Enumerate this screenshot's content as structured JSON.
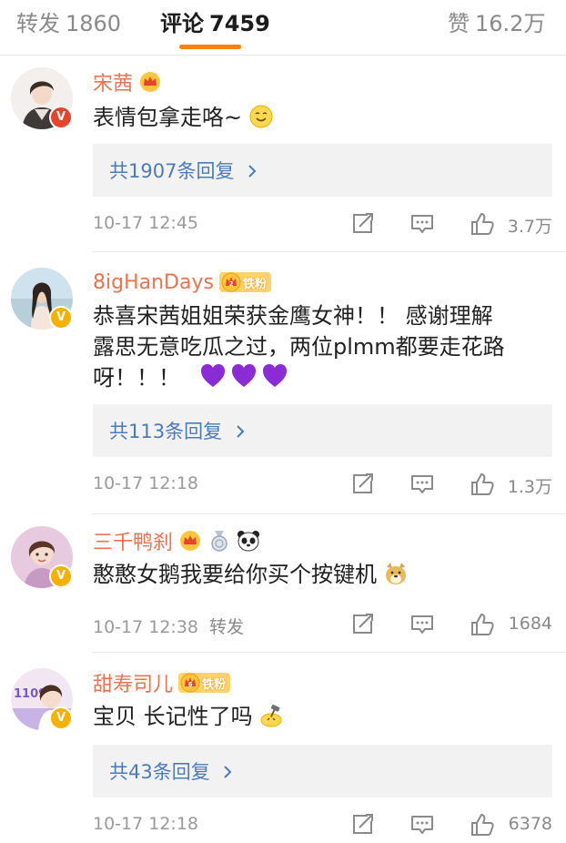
{
  "tabs": {
    "repost_label": "转发",
    "repost_count": "1860",
    "comment_label": "评论",
    "comment_count": "7459",
    "like_label": "赞",
    "like_count": "16.2万"
  },
  "comments": [
    {
      "name": "宋茜",
      "text": "表情包拿走咯~",
      "replies": "共1907条回复",
      "time": "10-17 12:45",
      "likes": "3.7万",
      "verified": "red"
    },
    {
      "name": "8igHanDays",
      "fan_badge": "铁粉",
      "fan_level": "2",
      "text_line1": "恭喜宋茜姐姐荣获金鹰女神！！ 感谢理解",
      "text_line2": "露思无意吃瓜之过，两位plmm都要走花路",
      "text_line3": "呀！！！",
      "replies": "共113条回复",
      "time": "10-17 12:18",
      "likes": "1.3万",
      "verified": "gold"
    },
    {
      "name": "三千鸭刹",
      "text": "憨憨女鹅我要给你买个按键机",
      "time": "10-17 12:38",
      "repost_tag": "转发",
      "likes": "1684",
      "verified": "gold"
    },
    {
      "name": "甜寿司儿",
      "fan_badge": "铁粉",
      "fan_level": "6",
      "text": "宝贝 长记性了吗",
      "replies": "共43条回复",
      "time": "10-17 12:18",
      "likes": "6378",
      "verified": "gold",
      "avatar_text": "1109"
    }
  ],
  "icons": {
    "repost": "repost-icon",
    "comment": "comment-icon",
    "like": "thumbs-up-icon",
    "chevron": "chevron-right-icon",
    "crown": "crown-icon"
  },
  "colors": {
    "accent": "#ff8200",
    "name": "#eb7350",
    "link": "#4b7bbf",
    "verified_red": "#e8442b",
    "verified_gold": "#f6b100"
  }
}
